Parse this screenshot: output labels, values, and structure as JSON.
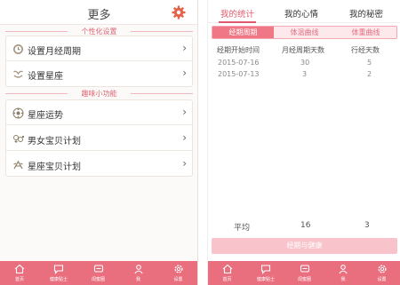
{
  "left": {
    "title": "更多",
    "section1": "个性化设置",
    "section2": "趣味小功能",
    "rows": [
      {
        "label": "设置月经周期",
        "icon": "clock-icon"
      },
      {
        "label": "设置星座",
        "icon": "zodiac-icon"
      },
      {
        "label": "星座运势",
        "icon": "astro-wheel-icon"
      },
      {
        "label": "男女宝贝计划",
        "icon": "gender-icon"
      },
      {
        "label": "星座宝贝计划",
        "icon": "star-baby-icon"
      }
    ],
    "chevron": "›"
  },
  "tabbar_left": [
    "首页",
    "健康贴士",
    "闺蜜圈",
    "我",
    "设置"
  ],
  "tabbar_right": [
    "首页",
    "健康贴士",
    "闺蜜圈",
    "我",
    "设置"
  ],
  "right": {
    "tabs": [
      "我的统计",
      "我的心情",
      "我的秘密"
    ],
    "segments": [
      "经期周期",
      "体温曲线",
      "体重曲线"
    ],
    "table": {
      "headers": [
        "经期开始时间",
        "月经周期天数",
        "行经天数"
      ],
      "rows": [
        [
          "2015-07-16",
          "30",
          "5"
        ],
        [
          "2015-07-13",
          "3",
          "2"
        ]
      ]
    },
    "avg_label": "平均",
    "avg_cycle": "16",
    "avg_days": "3",
    "button": "经期与健康"
  },
  "colors": {
    "accent": "#e96e7e",
    "pink_light": "#fde8ec",
    "text": "#333333"
  }
}
